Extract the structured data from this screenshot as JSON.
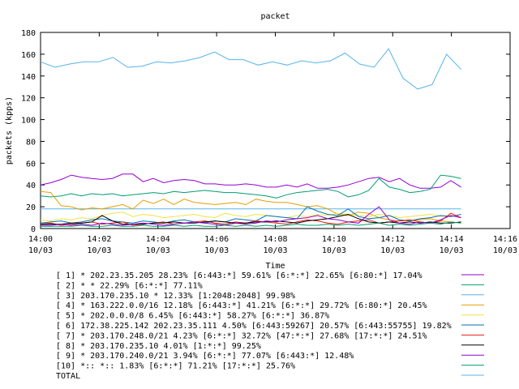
{
  "chart_data": {
    "type": "line",
    "title": "packet",
    "xlabel": "Time",
    "ylabel": "packets (kpps)",
    "ylim": [
      0,
      180
    ],
    "yticks": [
      0,
      20,
      40,
      60,
      80,
      100,
      120,
      140,
      160,
      180
    ],
    "xticks": [
      {
        "time": "14:00",
        "date": "10/03"
      },
      {
        "time": "14:02",
        "date": "10/03"
      },
      {
        "time": "14:04",
        "date": "10/03"
      },
      {
        "time": "14:06",
        "date": "10/03"
      },
      {
        "time": "14:08",
        "date": "10/03"
      },
      {
        "time": "14:10",
        "date": "10/03"
      },
      {
        "time": "14:12",
        "date": "10/03"
      },
      {
        "time": "14:14",
        "date": "10/03"
      },
      {
        "time": "14:16",
        "date": "10/03"
      }
    ],
    "x_minutes": [
      0,
      0.33,
      0.67,
      1.0,
      1.33,
      1.67,
      2.0,
      2.33,
      2.67,
      3.0,
      3.33,
      3.67,
      4.0,
      4.33,
      4.67,
      5.0,
      5.33,
      5.67,
      6.0,
      6.33,
      6.67,
      7.0,
      7.33,
      7.67,
      8.0,
      8.33,
      8.67,
      9.0,
      9.33,
      9.67,
      10.0,
      10.33,
      10.67,
      11.0,
      11.33,
      11.67,
      12.0,
      12.33,
      12.67,
      13.0,
      13.33,
      13.67,
      14.0,
      14.33
    ],
    "series": [
      {
        "name": "[ 1] * 202.23.35.205 28.23%  [6:443:*] 59.61% [6:*:*] 22.65% [6:80:*] 17.04%",
        "color": "#9400d3",
        "values": [
          40,
          42,
          45,
          49,
          47,
          46,
          45,
          46,
          50,
          50,
          43,
          46,
          42,
          44,
          45,
          44,
          41,
          41,
          40,
          40,
          41,
          40,
          38,
          38,
          40,
          38,
          41,
          37,
          37,
          38,
          40,
          43,
          46,
          47,
          43,
          46,
          40,
          37,
          37,
          38,
          44,
          38
        ]
      },
      {
        "name": "[ 2] * * 22.29%  [6:*:*] 77.11%",
        "color": "#009e73",
        "values": [
          30,
          29,
          30,
          32,
          30,
          32,
          31,
          32,
          30,
          31,
          32,
          33,
          32,
          34,
          33,
          34,
          35,
          34,
          33,
          33,
          32,
          31,
          30,
          28,
          31,
          33,
          34,
          35,
          36,
          34,
          29,
          31,
          35,
          46,
          38,
          36,
          33,
          34,
          36,
          49,
          48,
          46
        ]
      },
      {
        "name": "[ 3] 203.170.235.10 * 12.33%  [1:2048:2048] 99.98%",
        "color": "#56b4e9",
        "values": [
          18,
          18,
          18,
          18,
          18,
          18,
          18,
          18,
          18,
          18,
          18,
          18,
          18,
          18,
          18,
          18,
          18,
          18,
          18,
          18,
          18,
          18,
          18,
          18,
          18,
          18,
          18,
          18,
          18,
          18,
          18,
          18,
          18,
          18,
          18,
          18,
          18,
          18,
          18,
          18,
          18,
          18
        ]
      },
      {
        "name": "[ 4] * 163.222.0.0/16 12.18%  [6:443:*] 41.21% [6:*:*] 29.72% [6:80:*] 20.45%",
        "color": "#e69f00",
        "values": [
          34,
          33,
          21,
          20,
          17,
          19,
          18,
          20,
          22,
          18,
          26,
          23,
          27,
          22,
          27,
          24,
          23,
          22,
          23,
          24,
          22,
          27,
          25,
          24,
          24,
          22,
          20,
          21,
          18,
          13,
          12,
          15,
          14,
          10,
          8,
          7,
          7,
          8,
          9,
          7,
          6,
          5
        ]
      },
      {
        "name": "[ 5] * 202.0.0.0/8 6.45%  [6:443:*] 58.27% [6:*:*] 36.87%",
        "color": "#f0e442",
        "values": [
          8,
          7,
          9,
          8,
          10,
          9,
          12,
          14,
          15,
          11,
          13,
          12,
          10,
          11,
          12,
          13,
          11,
          10,
          14,
          12,
          11,
          13,
          12,
          11,
          10,
          12,
          11,
          13,
          12,
          14,
          13,
          12,
          11,
          13,
          12,
          10,
          11,
          12,
          13,
          11,
          12,
          10
        ]
      },
      {
        "name": "[ 6] 172.38.225.142 202.23.35.111 4.50%  [6:443:59267] 20.57% [6:443:55755] 19.82%",
        "color": "#0072b2",
        "values": [
          5,
          6,
          7,
          5,
          6,
          8,
          9,
          7,
          6,
          5,
          7,
          6,
          5,
          7,
          8,
          6,
          5,
          7,
          6,
          9,
          8,
          7,
          12,
          11,
          10,
          9,
          20,
          16,
          13,
          12,
          18,
          11,
          9,
          10,
          12,
          8,
          7,
          9,
          10,
          12,
          11,
          13
        ]
      },
      {
        "name": "[ 7] * 203.170.248.0/21 4.23%  [6:*:*] 32.72% [47:*:*] 27.68% [17:*:*] 24.51%",
        "color": "#e51e10",
        "values": [
          4,
          5,
          3,
          4,
          5,
          6,
          4,
          5,
          6,
          3,
          4,
          5,
          6,
          4,
          5,
          6,
          7,
          5,
          4,
          6,
          5,
          7,
          6,
          5,
          4,
          6,
          8,
          7,
          5,
          4,
          6,
          7,
          8,
          5,
          6,
          7,
          8,
          6,
          5,
          7,
          14,
          10
        ]
      },
      {
        "name": "[ 8] * 203.170.235.10 4.01%  [1:*:*] 99.25%",
        "color": "#000000",
        "values": [
          4,
          4,
          4,
          5,
          5,
          6,
          12,
          7,
          4,
          4,
          4,
          5,
          5,
          6,
          5,
          5,
          6,
          7,
          6,
          5,
          5,
          6,
          6,
          7,
          6,
          5,
          7,
          8,
          9,
          11,
          13,
          9,
          6,
          5,
          6,
          5,
          6,
          5,
          6,
          5,
          5,
          6
        ]
      },
      {
        "name": "[ 9] * 203.170.240.0/21 3.94%  [6:*:*] 77.07% [6:443:*] 12.48%",
        "color": "#9400d3",
        "values": [
          3,
          3,
          4,
          3,
          4,
          3,
          5,
          4,
          3,
          4,
          5,
          4,
          3,
          4,
          5,
          6,
          5,
          4,
          3,
          5,
          4,
          5,
          7,
          6,
          8,
          9,
          10,
          12,
          9,
          8,
          6,
          5,
          13,
          20,
          8,
          5,
          4,
          6,
          5,
          8,
          12,
          10
        ]
      },
      {
        "name": "[10] *:: *:: 1.83%  [6:*:*] 71.21% [17:*:*] 25.76%",
        "color": "#009e73",
        "values": [
          2,
          2,
          2,
          2,
          3,
          2,
          2,
          3,
          2,
          2,
          3,
          2,
          2,
          3,
          2,
          3,
          2,
          2,
          3,
          2,
          3,
          2,
          3,
          2,
          3,
          4,
          3,
          3,
          4,
          3,
          4,
          3,
          4,
          5,
          3,
          4,
          3,
          4,
          5,
          4,
          6,
          5
        ]
      },
      {
        "name": "TOTAL",
        "color": "#56b4e9",
        "values": [
          153,
          148,
          151,
          153,
          153,
          157,
          148,
          149,
          153,
          152,
          154,
          157,
          162,
          155,
          155,
          150,
          153,
          150,
          154,
          152,
          154,
          161,
          151,
          148,
          165,
          138,
          128,
          132,
          160,
          146
        ]
      }
    ]
  }
}
